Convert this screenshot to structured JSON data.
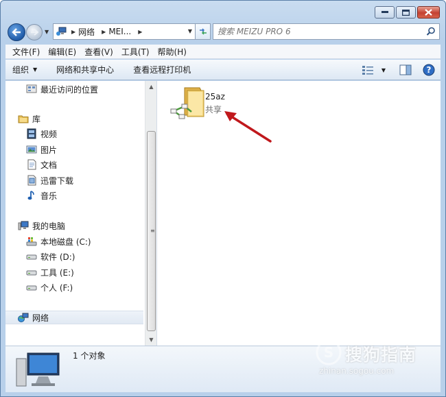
{
  "window": {
    "caption_buttons": [
      "minimize",
      "maximize",
      "close"
    ]
  },
  "address_bar": {
    "segments": [
      "网络",
      "MEI..."
    ],
    "search_placeholder": "搜索 MEIZU PRO 6"
  },
  "menu": {
    "items": [
      "文件(F)",
      "编辑(E)",
      "查看(V)",
      "工具(T)",
      "帮助(H)"
    ]
  },
  "commands": {
    "organize": "组织",
    "network_center": "网络和共享中心",
    "remote_printers": "查看远程打印机"
  },
  "navigation": {
    "items": [
      {
        "label": "最近访问的位置",
        "icon": "recent-places-icon",
        "level": 2
      },
      {
        "label": "库",
        "icon": "libraries-icon",
        "level": 1
      },
      {
        "label": "视频",
        "icon": "video-library-icon",
        "level": 2
      },
      {
        "label": "图片",
        "icon": "pictures-library-icon",
        "level": 2
      },
      {
        "label": "文档",
        "icon": "documents-library-icon",
        "level": 2
      },
      {
        "label": "迅雷下载",
        "icon": "downloads-library-icon",
        "level": 2
      },
      {
        "label": "音乐",
        "icon": "music-library-icon",
        "level": 2
      },
      {
        "label": "我的电脑",
        "icon": "computer-icon",
        "level": 1
      },
      {
        "label": "本地磁盘 (C:)",
        "icon": "system-drive-icon",
        "level": 2
      },
      {
        "label": "软件 (D:)",
        "icon": "drive-icon",
        "level": 2
      },
      {
        "label": "工具 (E:)",
        "icon": "drive-icon",
        "level": 2
      },
      {
        "label": "个人 (F:)",
        "icon": "drive-icon",
        "level": 2
      },
      {
        "label": "网络",
        "icon": "network-icon",
        "level": 1,
        "selected": true
      }
    ]
  },
  "content": {
    "items": [
      {
        "name": "25az",
        "subtitle": "共享",
        "icon": "shared-folder-icon"
      }
    ]
  },
  "details": {
    "count_text": "1 个对象"
  },
  "watermark": {
    "text": "搜狗指南",
    "url": "zhinan.sogou.com"
  },
  "colors": {
    "frame": "#b8d0ea",
    "arrow": "#c0181c",
    "selection": "#e1e9f3"
  }
}
